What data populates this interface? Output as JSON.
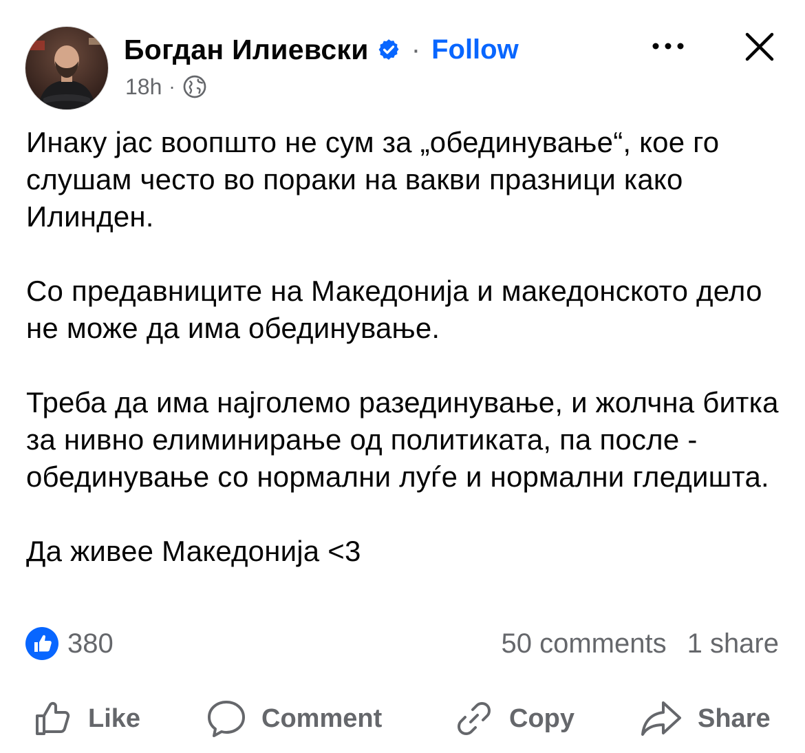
{
  "post": {
    "author": {
      "name": "Богдан Илиевски",
      "verified": true,
      "separator": "·",
      "follow_label": "Follow"
    },
    "timestamp": "18h",
    "meta_separator": "·",
    "audience_icon": "globe-icon",
    "paragraphs": [
      "Инаку јас воопшто не сум за „обединување“, кое го слушам често во пораки на вакви празници како Илинден.",
      "Со предавниците на Македонија и македонското дело не може да има обединување.",
      "Треба да има најголемо разединување, и жолчна битка за нивно елиминирање од политиката, па после - обединување со нормални луѓе и нормални гледишта.",
      "Да живее Македонија <3"
    ]
  },
  "stats": {
    "reactions": "380",
    "comments": "50 comments",
    "shares": "1 share"
  },
  "actions": {
    "like": "Like",
    "comment": "Comment",
    "copy": "Copy",
    "share": "Share"
  },
  "colors": {
    "accent": "#0866ff",
    "secondary_text": "#65676b",
    "primary_text": "#050505"
  }
}
